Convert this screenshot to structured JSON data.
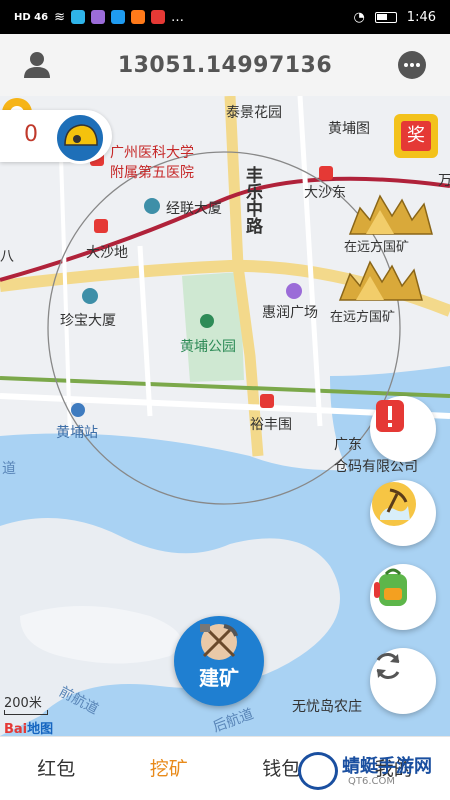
{
  "statusbar": {
    "left": "HD 46",
    "time": "1:46"
  },
  "header": {
    "title": "13051.14997136"
  },
  "counter": {
    "value": "0"
  },
  "reward": {
    "label": "奖"
  },
  "map": {
    "labels": {
      "taijing": "泰景花园",
      "huangputu": "黄埔图",
      "hospital1": "广州医科大学",
      "hospital2": "附属第五医院",
      "fengle": "丰乐中路",
      "dashadong": "大沙东",
      "jinglian": "经联大厦",
      "dashadi": "大沙地",
      "zhenbao": "珍宝大厦",
      "huirun": "惠润广场",
      "park": "黄埔公园",
      "huangpuzhan": "黄埔站",
      "yufengwei": "裕丰围",
      "guangdong": "广东",
      "cangma": "仓码有限公司",
      "wuyoudao": "无忧岛农庄",
      "qianhangdao": "前航道",
      "houhangdao": "后航道",
      "dao": "道",
      "ba": "八",
      "wan": "万",
      "mine1": "在远方国矿",
      "mine2": "在远方国矿"
    },
    "scale": "200米",
    "baidu": "Bai",
    "baidu2": "地图"
  },
  "build": {
    "label": "建矿"
  },
  "tabs": [
    "红包",
    "挖矿",
    "钱包",
    "我的"
  ],
  "watermark": {
    "name": "蜻蜓手游网",
    "url": "QT6.COM"
  },
  "colors": {
    "accent": "#e88a1a",
    "build": "#1f7fd1",
    "metro": "#b0223a"
  }
}
